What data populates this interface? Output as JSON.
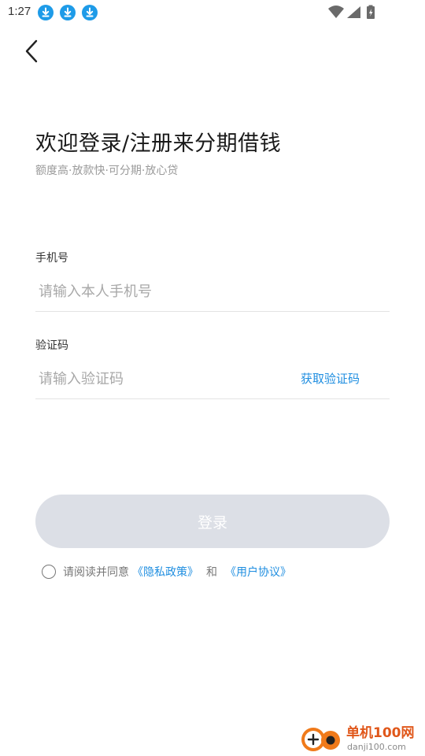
{
  "status_bar": {
    "time": "1:27",
    "notification_icons": [
      "download-icon",
      "download-icon",
      "download-icon"
    ],
    "system_icons": [
      "wifi-icon",
      "signal-icon",
      "battery-icon"
    ]
  },
  "header": {
    "back_icon": "chevron-left-icon"
  },
  "main": {
    "title": "欢迎登录/注册来分期借钱",
    "subtitle": "额度高·放款快·可分期·放心贷",
    "phone": {
      "label": "手机号",
      "placeholder": "请输入本人手机号",
      "value": ""
    },
    "code": {
      "label": "验证码",
      "placeholder": "请输入验证码",
      "value": "",
      "get_code_label": "获取验证码"
    },
    "login_label": "登录",
    "agreement": {
      "checked": false,
      "prefix": "请阅读并同意",
      "privacy_link": "《隐私政策》",
      "and": "和",
      "user_link": "《用户协议》"
    }
  },
  "watermark": {
    "brand": "单机100网",
    "url": "danji100.com"
  },
  "colors": {
    "accent": "#1f8ee0",
    "button_disabled": "#dcdfe6",
    "download_badge": "#1e9be8",
    "watermark_orange": "#f07a1a"
  }
}
